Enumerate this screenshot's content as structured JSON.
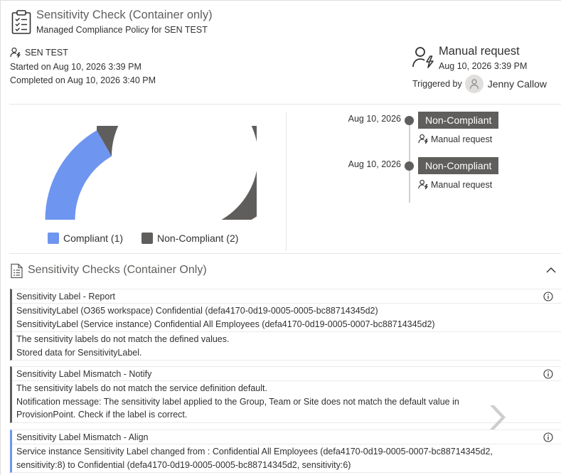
{
  "header": {
    "title": "Sensitivity Check (Container only)",
    "subtitle": "Managed Compliance Policy for SEN TEST"
  },
  "run": {
    "owner": "SEN TEST",
    "started": "Started on Aug 10, 2026 3:39 PM",
    "completed": "Completed on Aug 10, 2026 3:40 PM"
  },
  "trigger": {
    "title": "Manual request",
    "date": "Aug 10, 2026 3:39 PM",
    "by_label": "Triggered by",
    "user": "Jenny Callow"
  },
  "gauge": {
    "compliant_count": 1,
    "non_compliant_count": 2,
    "compliant_color": "#6e95f0",
    "non_compliant_color": "#605e5c",
    "legend": {
      "compliant": "Compliant (1)",
      "non_compliant": "Non-Compliant (2)"
    }
  },
  "timeline": [
    {
      "date": "Aug 10, 2026",
      "status": "Non-Compliant",
      "trigger": "Manual request"
    },
    {
      "date": "Aug 10, 2026",
      "status": "Non-Compliant",
      "trigger": "Manual request"
    }
  ],
  "section": {
    "title": "Sensitivity Checks (Container Only)"
  },
  "checks": [
    {
      "title": "Sensitivity Label - Report",
      "lines_a": [
        "SensitivityLabel (O365 workspace) Confidential (defa4170-0d19-0005-0005-bc88714345d2)",
        "SensitivityLabel (Service instance) Confidential All Employees (defa4170-0d19-0005-0007-bc88714345d2)"
      ],
      "lines_b": [
        "The sensitivity labels do not match the defined values.",
        "Stored data for SensitivityLabel."
      ]
    },
    {
      "title": "Sensitivity Label Mismatch - Notify",
      "lines_a": [
        "The sensitivity labels do not match the service definition default.",
        "Notification message: The sensitivity label applied to the Group, Team or Site does not match the default value in",
        "ProvisionPoint. Check if the label is correct."
      ]
    },
    {
      "title": "Sensitivity Label Mismatch - Align",
      "lines_a": [
        "Service instance Sensitivity Label changed from : Confidential All Employees (defa4170-0d19-0005-0007-bc88714345d2,",
        "sensitivity:8) to Confidential (defa4170-0d19-0005-0005-bc88714345d2, sensitivity:6)"
      ]
    }
  ]
}
